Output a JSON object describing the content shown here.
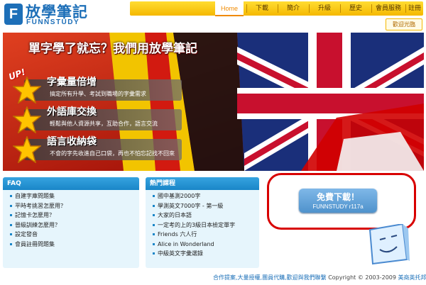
{
  "logo": {
    "mark": "F",
    "title": "放學筆記",
    "subtitle": "FUNNSTUDY"
  },
  "nav": {
    "items": [
      "Home",
      "下載",
      "簡介",
      "升級",
      "歷史",
      "會員服務",
      "註冊"
    ],
    "active_index": 0
  },
  "welcome_button": "歡迎光臨",
  "banner": {
    "title": "單字學了就忘？我們用放學筆記",
    "badge": "UP!",
    "features": [
      {
        "title": "字彙量倍增",
        "desc": "搞定所有升學、考試到職場的字彙需求"
      },
      {
        "title": "外語庫交換",
        "desc": "輕鬆與他人資源共享，互助合作，語言交流"
      },
      {
        "title": "語言收納袋",
        "desc": "不會的字先收進自己口袋，再也不怕忘記找不回來"
      }
    ]
  },
  "faq": {
    "heading": "FAQ",
    "items": [
      "自建字庫問題集",
      "平時考挑習怎麼用？",
      "記憶卡怎麼用？",
      "晉級訓練怎麼用？",
      "設定發音",
      "會員註冊問題集"
    ]
  },
  "courses": {
    "heading": "熱門課程",
    "items": [
      "國中基測2000字",
      "學測英文7000字 - 第一級",
      "大家的日本語",
      "一定考的上的3級日本檢定單字",
      "Friends 六人行",
      "Alice in Wonderland",
      "中級英文字彙選錄"
    ]
  },
  "download": {
    "label": "免費下載！",
    "version": "FUNNSTUDY r117a"
  },
  "footer": {
    "links": "合作提案,大量授權,團員代購,歡迎與我們聯繫",
    "copyright": "Copyright © 2003-2009",
    "company": "美商英托邦"
  },
  "colors": {
    "brand": "#1d6fb8",
    "nav": "#f5b800",
    "accent": "#d80000",
    "box_head": "#1a86c8"
  }
}
